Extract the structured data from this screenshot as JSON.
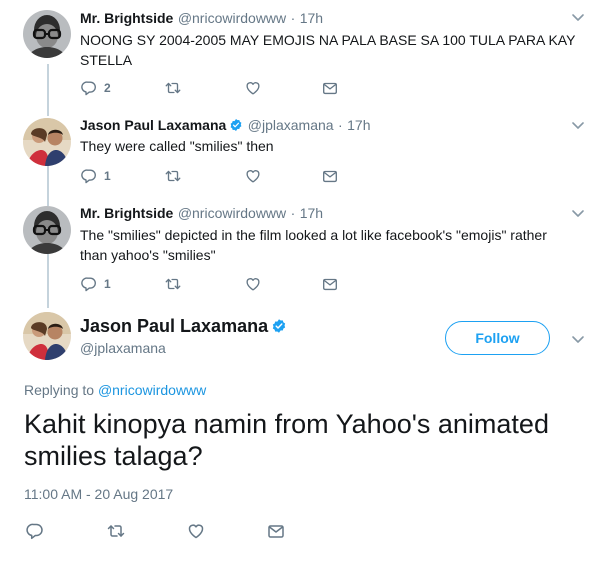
{
  "tweets": [
    {
      "name": "Mr. Brightside",
      "handle": "@nricowirdowww",
      "time": "17h",
      "text_lines": [
        "NOONG SY 2004-2005 MAY EMOJIS NA PALA BASE SA 100 TULA PARA KAY",
        "STELLA"
      ],
      "reply_count": "2",
      "retweet_count": "",
      "like_count": "",
      "verified": false
    },
    {
      "name": "Jason Paul Laxamana",
      "handle": "@jplaxamana",
      "time": "17h",
      "text_lines": [
        "They were called \"smilies\" then"
      ],
      "reply_count": "1",
      "retweet_count": "",
      "like_count": "",
      "verified": true
    },
    {
      "name": "Mr. Brightside",
      "handle": "@nricowirdowww",
      "time": "17h",
      "text_lines": [
        "The \"smilies\" depicted in the film looked a lot like facebook's \"emojis\" rather",
        "than yahoo's \"smilies\""
      ],
      "reply_count": "1",
      "retweet_count": "",
      "like_count": "",
      "verified": false
    }
  ],
  "main_tweet": {
    "name": "Jason Paul Laxamana",
    "handle": "@jplaxamana",
    "follow_label": "Follow",
    "replying_prefix": "Replying to",
    "replying_to": "@nricowirdowww",
    "text_lines": [
      "Kahit kinopya namin from Yahoo's animated",
      "smilies talaga?"
    ],
    "timestamp": "11:00 AM - 20 Aug 2017"
  },
  "separator": "·",
  "icons": {
    "reply": "reply-icon",
    "retweet": "retweet-icon",
    "like": "heart-icon",
    "dm": "envelope-icon",
    "menu": "chevron-down-icon",
    "verified": "verified-badge-icon"
  },
  "colors": {
    "accent": "#1da1f2",
    "link": "#1b95e0",
    "muted": "#657786",
    "text": "#14171a",
    "thread_line": "#c5d3dc"
  }
}
